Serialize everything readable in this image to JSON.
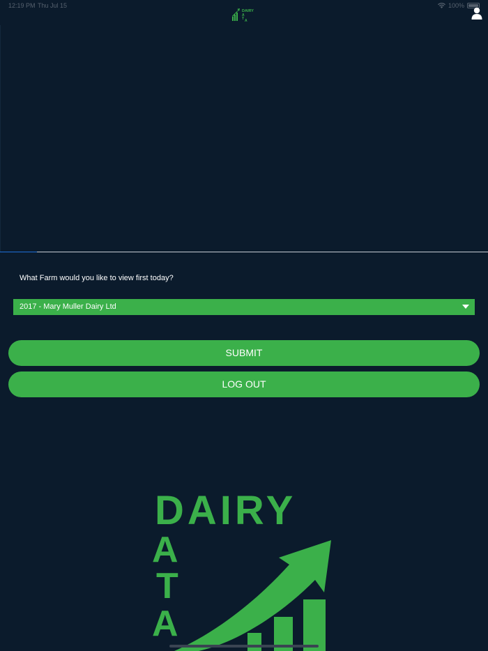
{
  "status_bar": {
    "time": "12:19 PM",
    "date": "Thu Jul 15",
    "battery": "100%"
  },
  "header": {
    "logo_text": "DAIRY DATA",
    "profile_icon": "person-icon"
  },
  "progress": {
    "fraction": 0.076
  },
  "main": {
    "question": "What Farm would you like to view first today?",
    "farm_select": {
      "selected": "2017 - Mary Muller Dairy Ltd"
    },
    "submit_label": "SUBMIT",
    "logout_label": "LOG OUT"
  },
  "brand": {
    "word_top": "DAIRY",
    "letters": [
      "D",
      "A",
      "T",
      "A"
    ]
  },
  "colors": {
    "background": "#0b1b2c",
    "accent_green": "#3bb04a",
    "progress_blue": "#1e6fd9"
  }
}
